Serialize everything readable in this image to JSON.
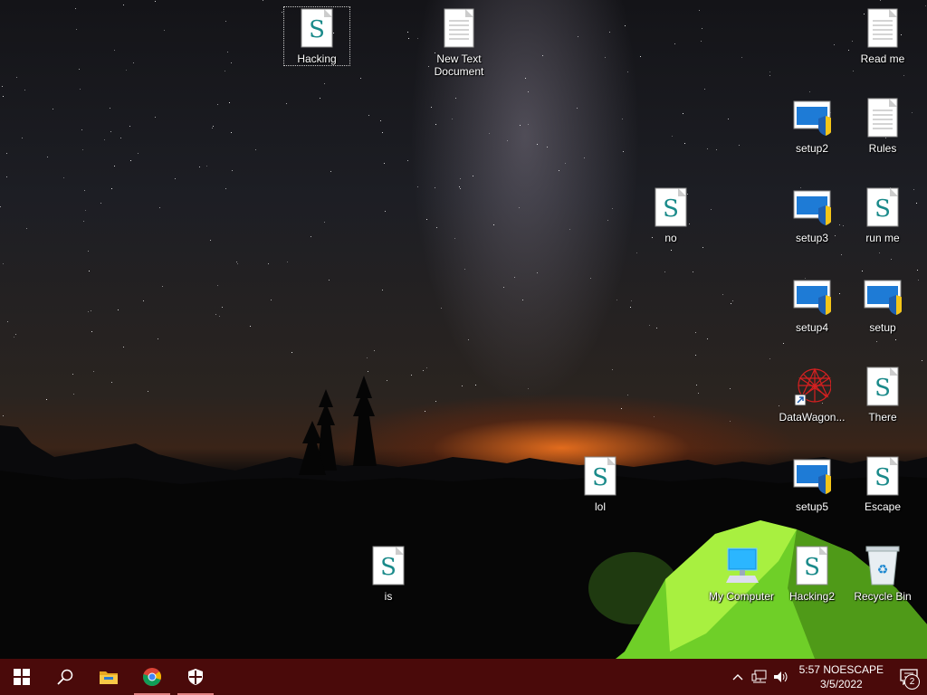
{
  "desktop": {
    "icons": {
      "hacking": {
        "label": "Hacking",
        "type": "script"
      },
      "new_text_document": {
        "label": "New Text Document",
        "type": "text"
      },
      "read_me": {
        "label": "Read me",
        "type": "text"
      },
      "setup2": {
        "label": "setup2",
        "type": "installer"
      },
      "rules": {
        "label": "Rules",
        "type": "text"
      },
      "no": {
        "label": "no",
        "type": "script"
      },
      "setup3": {
        "label": "setup3",
        "type": "installer"
      },
      "run_me": {
        "label": "run me",
        "type": "script"
      },
      "setup4": {
        "label": "setup4",
        "type": "installer"
      },
      "setup": {
        "label": "setup",
        "type": "installer"
      },
      "datawagon": {
        "label": "DataWagon...",
        "type": "shortcut"
      },
      "there": {
        "label": "There",
        "type": "script"
      },
      "lol": {
        "label": "lol",
        "type": "script"
      },
      "setup5": {
        "label": "setup5",
        "type": "installer"
      },
      "escape": {
        "label": "Escape",
        "type": "script"
      },
      "is": {
        "label": "is",
        "type": "script"
      },
      "my_computer": {
        "label": "My Computer",
        "type": "computer"
      },
      "hacking2": {
        "label": "Hacking2",
        "type": "script"
      },
      "recycle_bin": {
        "label": "Recycle Bin",
        "type": "recycle-bin"
      }
    }
  },
  "taskbar": {
    "color": "#4a0a0a",
    "buttons": [
      "windows-start-icon",
      "search-icon",
      "file-explorer-icon",
      "chrome-icon",
      "security-shield-icon"
    ],
    "tray": {
      "clock_time": "5:57 NOESCAPE",
      "clock_date": "3/5/2022",
      "notification_count": "2"
    }
  }
}
